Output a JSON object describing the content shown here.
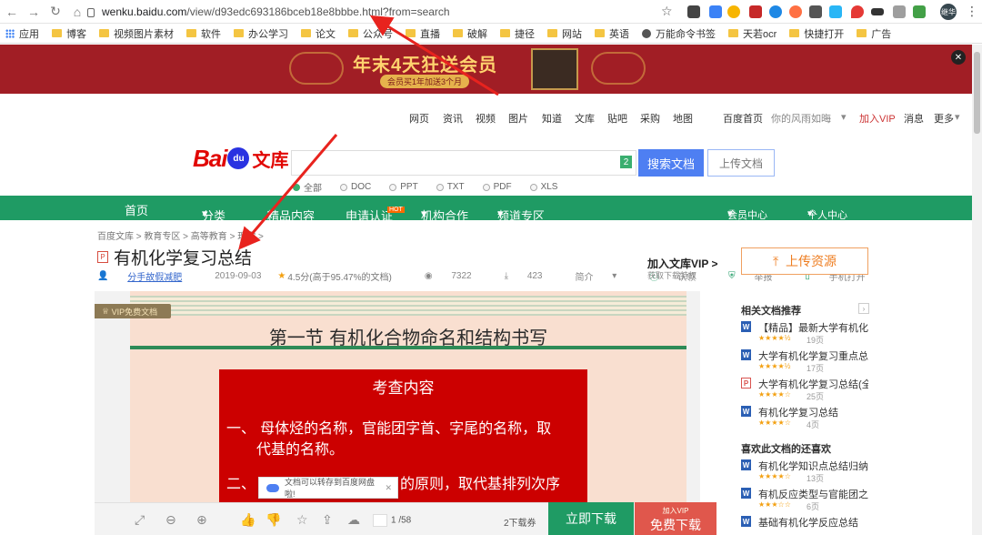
{
  "browser": {
    "url_host": "wenku.baidu.com",
    "url_path": "/view/d93edc693186bceb18e8bbbe.html?from=search",
    "profile_label": "继华"
  },
  "bookmarks": [
    "应用",
    "博客",
    "视频图片素材",
    "软件",
    "办公学习",
    "论文",
    "公众号",
    "直播",
    "破解",
    "捷径",
    "网站",
    "英语",
    "万能命令书签",
    "天若ocr",
    "快捷打开",
    "广告"
  ],
  "banner": {
    "title": "年末4天狂送会员",
    "subtitle": "会员买1年加送3个月"
  },
  "topnav": {
    "links": [
      "网页",
      "资讯",
      "视频",
      "图片",
      "知道",
      "文库",
      "贴吧",
      "采购",
      "地图"
    ],
    "home": "百度首页",
    "user": "你的风雨如晦",
    "vip": "加入VIP",
    "msg": "消息",
    "more": "更多"
  },
  "logo": {
    "bai": "Bai",
    "du": "du",
    "wenku": "文库"
  },
  "search": {
    "badge": "2",
    "button": "搜索文档",
    "upload": "上传文档",
    "filters": [
      "全部",
      "DOC",
      "PPT",
      "TXT",
      "PDF",
      "XLS"
    ]
  },
  "greennav": {
    "items": [
      "首页",
      "分类",
      "精品内容",
      "申请认证",
      "机构合作",
      "频道专区"
    ],
    "hot": "HOT",
    "member": "会员中心",
    "personal": "个人中心"
  },
  "doc": {
    "breadcrumb": "百度文库 > 教育专区 > 高等教育 > 理学 >",
    "file_type": "P",
    "title": "有机化学复习总结",
    "author": "分手故假减肥",
    "date": "2019-09-03",
    "rating": "4.5分(高于95.47%的文档)",
    "views": "7322",
    "downloads": "423",
    "intro": "简介",
    "cert": "认领",
    "report": "举报",
    "mobile": "手机打开",
    "join_vip": "加入文库VIP >",
    "join_vip_sub": "获取下载特权",
    "upload_res": "上传资源"
  },
  "viewer": {
    "vip_ribbon": "VIP免费文档",
    "heading": "第一节  有机化合物命名和结构书写",
    "box_title": "考查内容",
    "line1a": "一、 母体烃的名称，官能团字首、字尾的名称，取",
    "line1b": "代基的名称。",
    "line2a": "二、",
    "line2b": "的原则，取代基排列次序",
    "tooltip": "文档可以转存到百度网盘啦!",
    "page_total": "1 /58",
    "coupon": "2下载券",
    "download_now": "立即下载",
    "free_vip": "加入VIP",
    "free_download": "免费下载"
  },
  "sidebar": {
    "related_title": "相关文档推荐",
    "related": [
      {
        "name": "【精品】最新大学有机化...",
        "stars": "★★★★½",
        "pages": "19页",
        "type": "W"
      },
      {
        "name": "大学有机化学复习重点总...",
        "stars": "★★★★½",
        "pages": "17页",
        "type": "W"
      },
      {
        "name": "大学有机化学复习总结(全...",
        "stars": "★★★★☆",
        "pages": "25页",
        "type": "P"
      },
      {
        "name": "有机化学复习总结",
        "stars": "★★★★☆",
        "pages": "4页",
        "type": "W"
      }
    ],
    "also_title": "喜欢此文档的还喜欢",
    "also": [
      {
        "name": "有机化学知识点总结归纳...",
        "stars": "★★★★☆",
        "pages": "13页",
        "type": "W"
      },
      {
        "name": "有机反应类型与官能团之...",
        "stars": "★★★☆☆",
        "pages": "6页",
        "type": "W"
      },
      {
        "name": "基础有机化学反应总结",
        "stars": "★★★★☆",
        "pages": "",
        "type": "W"
      }
    ]
  }
}
